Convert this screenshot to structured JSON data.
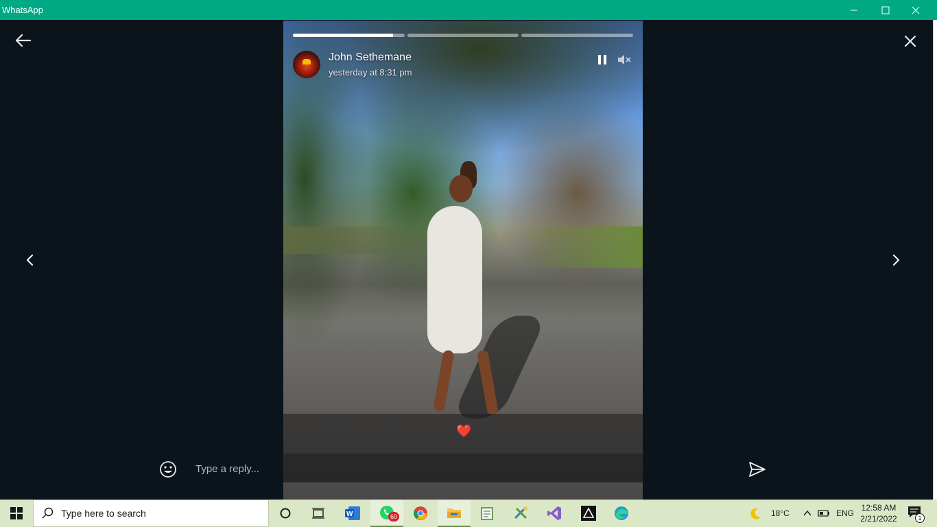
{
  "window": {
    "title": "WhatsApp",
    "accent": "#00a884"
  },
  "status": {
    "contact_name": "John Sethemane",
    "timestamp": "yesterday at 8:31 pm",
    "progress": [
      0.9,
      0,
      0
    ],
    "caption": "❤️",
    "reply_placeholder": "Type a reply..."
  },
  "taskbar": {
    "search_placeholder": "Type here to search",
    "apps": [
      {
        "name": "task-view-icon"
      },
      {
        "name": "widgets-icon"
      },
      {
        "name": "word-icon"
      },
      {
        "name": "whatsapp-icon",
        "badge": "60"
      },
      {
        "name": "chrome-icon"
      },
      {
        "name": "file-explorer-icon"
      },
      {
        "name": "notepad-icon"
      },
      {
        "name": "excel-like-icon"
      },
      {
        "name": "visual-studio-icon"
      },
      {
        "name": "git-icon"
      },
      {
        "name": "edge-icon"
      }
    ],
    "weather": "18°C",
    "language": "ENG",
    "time": "12:58 AM",
    "date": "2/21/2022",
    "notification_count": "1"
  }
}
